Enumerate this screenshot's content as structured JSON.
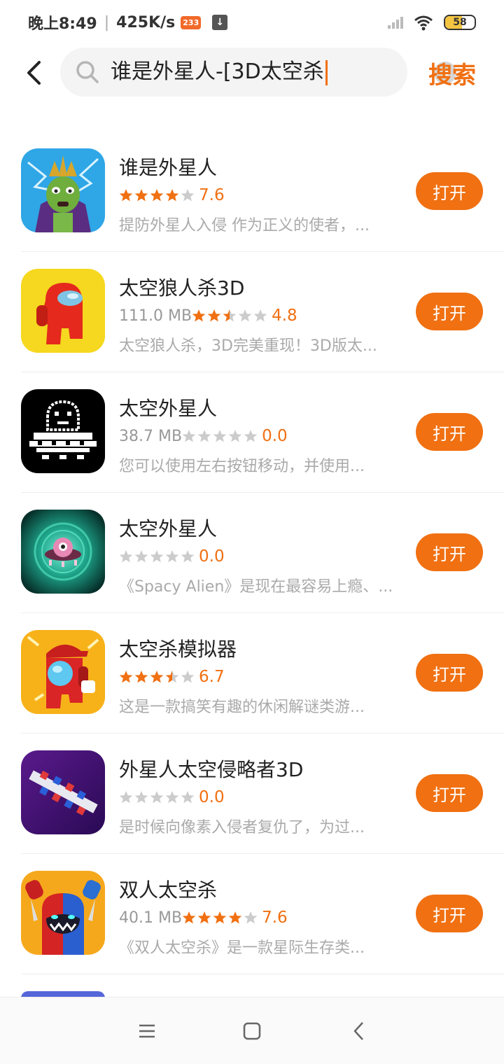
{
  "status_bar": {
    "time": "晚上8:49",
    "speed": "425K/s",
    "badge": "233",
    "download_icon": "download-icon",
    "battery": "58"
  },
  "search": {
    "query": "谁是外星人-[3D太空杀",
    "button_label": "搜索"
  },
  "colors": {
    "accent": "#f07012",
    "star_off": "#cccccc"
  },
  "apps": [
    {
      "name": "谁是外星人",
      "size": "",
      "stars": 4,
      "rating": "7.6",
      "desc": "提防外星人入侵 作为正义的使者，...",
      "button": "打开"
    },
    {
      "name": "太空狼人杀3D",
      "size": "111.0 MB",
      "stars": 2.5,
      "rating": "4.8",
      "desc": "太空狼人杀，3D完美重现！3D版太...",
      "button": "打开"
    },
    {
      "name": "太空外星人",
      "size": "38.7 MB",
      "stars": 0,
      "rating": "0.0",
      "desc": "您可以使用左右按钮移动，并使用...",
      "button": "打开"
    },
    {
      "name": "太空外星人",
      "size": "",
      "stars": 0,
      "rating": "0.0",
      "desc": "《Spacy Alien》是现在最容易上瘾、...",
      "button": "打开"
    },
    {
      "name": "太空杀模拟器",
      "size": "",
      "stars": 3.5,
      "rating": "6.7",
      "desc": "这是一款搞笑有趣的休闲解谜类游...",
      "button": "打开"
    },
    {
      "name": "外星人太空侵略者3D",
      "size": "",
      "stars": 0,
      "rating": "0.0",
      "desc": "是时候向像素入侵者复仇了，为过...",
      "button": "打开"
    },
    {
      "name": "双人太空杀",
      "size": "40.1 MB",
      "stars": 4,
      "rating": "7.6",
      "desc": "《双人太空杀》是一款星际生存类...",
      "button": "打开"
    }
  ]
}
